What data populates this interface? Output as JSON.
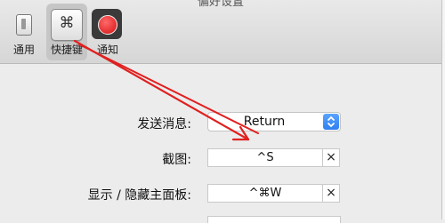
{
  "window": {
    "title_fragment": "偏好设置"
  },
  "toolbar": {
    "items": [
      {
        "label": "通用",
        "icon": "general-icon",
        "selected": false
      },
      {
        "label": "快捷键",
        "icon": "command-key-icon",
        "glyph": "⌘",
        "selected": true
      },
      {
        "label": "通知",
        "icon": "notification-icon",
        "selected": false
      }
    ]
  },
  "shortcuts": {
    "send": {
      "label": "发送消息:",
      "value": "Return"
    },
    "screenshot": {
      "label": "截图:",
      "value": "^S",
      "clear": "×"
    },
    "toggle_panel": {
      "label": "显示 / 隐藏主面板:",
      "value": "^⌘W",
      "clear": "×"
    }
  },
  "colors": {
    "arrow": "#e02020",
    "accent": "#2f7ff0"
  }
}
